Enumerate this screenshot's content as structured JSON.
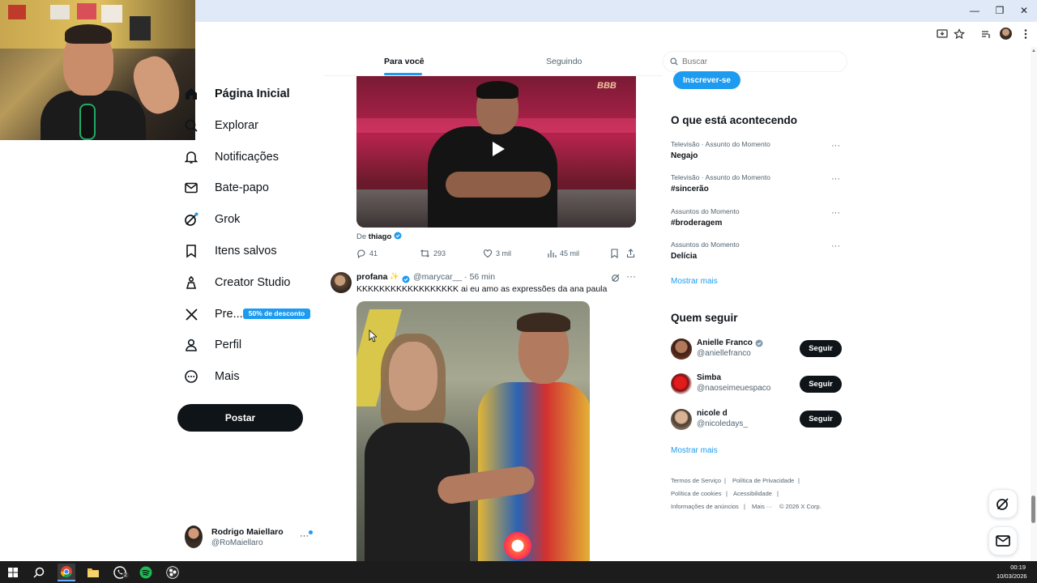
{
  "browser": {
    "window_controls": [
      "—",
      "❐",
      "✕"
    ]
  },
  "nav": {
    "items": [
      {
        "label": "Página Inicial",
        "icon": "home-icon",
        "bold": true
      },
      {
        "label": "Explorar",
        "icon": "search-icon"
      },
      {
        "label": "Notificações",
        "icon": "bell-icon"
      },
      {
        "label": "Bate-papo",
        "icon": "mail-icon"
      },
      {
        "label": "Grok",
        "icon": "grok-icon"
      },
      {
        "label": "Itens salvos",
        "icon": "bookmark-icon"
      },
      {
        "label": "Creator Studio",
        "icon": "creator-studio-icon"
      },
      {
        "label": "Pre...",
        "icon": "x-logo-icon"
      },
      {
        "label": "Perfil",
        "icon": "person-icon"
      },
      {
        "label": "Mais",
        "icon": "more-circle-icon"
      }
    ],
    "promo_badge": "50% de desconto",
    "post_button": "Postar",
    "account": {
      "name": "Rodrigo Maiellaro",
      "handle": "@RoMaiellaro"
    }
  },
  "feed": {
    "tabs": [
      {
        "label": "Para você",
        "active": true
      },
      {
        "label": "Seguindo",
        "active": false
      }
    ],
    "tweet1": {
      "video_logo": "BBB",
      "via_prefix": "De ",
      "via_user": "thiago",
      "metrics": {
        "replies": "41",
        "reposts": "293",
        "likes": "3 mil",
        "views": "45 mil"
      }
    },
    "tweet2": {
      "name": "profana",
      "sparkle": "✨",
      "handle_time": "@marycar__ · 56 min",
      "text": "KKKKKKKKKKKKKKKKKK ai eu amo as expressões da ana paula"
    }
  },
  "sidebar": {
    "search_placeholder": "Buscar",
    "subscribe_label": "Inscrever-se",
    "trends_title": "O que está acontecendo",
    "trends": [
      {
        "category": "Televisão · Assunto do Momento",
        "name": "Negajo"
      },
      {
        "category": "Televisão · Assunto do Momento",
        "name": "#sincerão"
      },
      {
        "category": "Assuntos do Momento",
        "name": "#broderagem"
      },
      {
        "category": "Assuntos do Momento",
        "name": "Delícia"
      }
    ],
    "show_more": "Mostrar mais",
    "who_to_follow_title": "Quem seguir",
    "follow": [
      {
        "name": "Anielle Franco",
        "handle": "@aniellefranco",
        "verified": true,
        "button": "Seguir"
      },
      {
        "name": "Simba",
        "handle": "@naoseimeuespaco",
        "verified": false,
        "button": "Seguir"
      },
      {
        "name": "nicole d",
        "handle": "@nicoledays_",
        "verified": false,
        "button": "Seguir"
      }
    ],
    "footer": [
      "Termos de Serviço",
      "|",
      "Política de Privacidade",
      "|",
      "Política de cookies",
      "|",
      "Acessibilidade",
      "|",
      "Informações de anúncios",
      "|",
      "Mais ···",
      "© 2026 X Corp."
    ]
  },
  "taskbar": {
    "time": "00:19",
    "date": "10/03/2026",
    "whatsapp_badge": "2"
  },
  "colors": {
    "accent": "#1d9bf0",
    "text": "#0f1419",
    "muted": "#536471",
    "taskbar": "#1c1c1c"
  }
}
